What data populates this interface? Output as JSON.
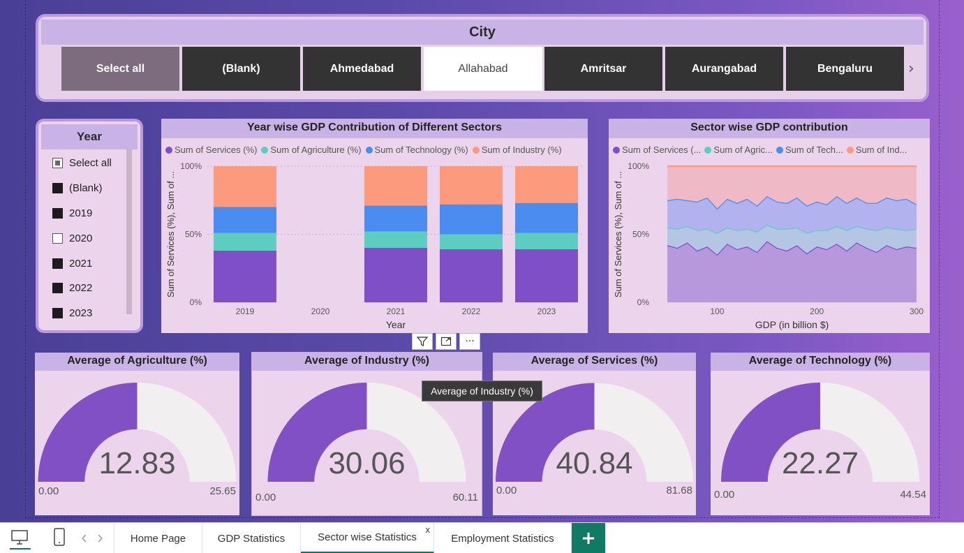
{
  "city_slicer": {
    "title": "City",
    "items": [
      "Select all",
      "(Blank)",
      "Ahmedabad",
      "Allahabad",
      "Amritsar",
      "Aurangabad",
      "Bengaluru"
    ],
    "selected": "Allahabad",
    "next_arrow": "›"
  },
  "year_slicer": {
    "title": "Year",
    "items": [
      {
        "label": "Select all",
        "state": "partial"
      },
      {
        "label": "(Blank)",
        "state": "checked"
      },
      {
        "label": "2019",
        "state": "checked"
      },
      {
        "label": "2020",
        "state": "unchecked"
      },
      {
        "label": "2021",
        "state": "checked"
      },
      {
        "label": "2022",
        "state": "checked"
      },
      {
        "label": "2023",
        "state": "checked"
      }
    ]
  },
  "colors": {
    "services": "#7f4fc7",
    "agriculture": "#5ccdc0",
    "technology": "#4a8cf0",
    "industry": "#fb9a7c"
  },
  "chart_data": [
    {
      "type": "bar",
      "stacked": "percent",
      "title": "Year wise GDP Contribution of Different Sectors",
      "legend": [
        "Sum of Services (%)",
        "Sum of Agriculture (%)",
        "Sum of Technology (%)",
        "Sum of Industry (%)"
      ],
      "xlabel": "Year",
      "ylabel": "Sum of Services (%), Sum of ...",
      "yticks": [
        "0%",
        "50%",
        "100%"
      ],
      "categories": [
        "2019",
        "2020",
        "2021",
        "2022",
        "2023"
      ],
      "series": [
        {
          "name": "Sum of Services (%)",
          "values": [
            38,
            null,
            40,
            39,
            39
          ]
        },
        {
          "name": "Sum of Agriculture (%)",
          "values": [
            13,
            null,
            12,
            11,
            12
          ]
        },
        {
          "name": "Sum of Technology (%)",
          "values": [
            19,
            null,
            19,
            22,
            22
          ]
        },
        {
          "name": "Sum of Industry (%)",
          "values": [
            30,
            null,
            29,
            28,
            27
          ]
        }
      ]
    },
    {
      "type": "area",
      "stacked": "percent",
      "title": "Sector wise GDP contribution",
      "legend": [
        "Sum of Services (...",
        "Sum of Agric...",
        "Sum of Tech...",
        "Sum of Ind..."
      ],
      "xlabel": "GDP (in billion $)",
      "ylabel": "Sum of Services (%), Sum of ...",
      "yticks": [
        "0%",
        "50%",
        "100%"
      ],
      "xticks": [
        "100",
        "200",
        "300"
      ],
      "xlim": [
        50,
        300
      ],
      "x": [
        50,
        60,
        70,
        80,
        90,
        100,
        110,
        120,
        130,
        140,
        150,
        160,
        170,
        180,
        190,
        200,
        210,
        220,
        230,
        240,
        250,
        260,
        270,
        280,
        290,
        300
      ],
      "series": [
        {
          "name": "Sum of Services (%)",
          "values": [
            42,
            40,
            44,
            38,
            41,
            35,
            43,
            39,
            41,
            37,
            45,
            40,
            38,
            42,
            36,
            41,
            39,
            43,
            38,
            44,
            40,
            37,
            42,
            39,
            41,
            40
          ]
        },
        {
          "name": "Sum of Agriculture (%)",
          "values": [
            13,
            14,
            12,
            15,
            13,
            16,
            12,
            14,
            13,
            15,
            12,
            14,
            16,
            13,
            15,
            12,
            14,
            13,
            15,
            12,
            14,
            16,
            13,
            15,
            12,
            14
          ]
        },
        {
          "name": "Sum of Technology (%)",
          "values": [
            20,
            22,
            19,
            21,
            23,
            18,
            21,
            20,
            22,
            19,
            21,
            20,
            19,
            22,
            20,
            21,
            19,
            22,
            20,
            21,
            19,
            20,
            22,
            21,
            23,
            18
          ]
        },
        {
          "name": "Sum of Industry (%)",
          "values": [
            25,
            24,
            25,
            26,
            23,
            31,
            24,
            27,
            24,
            29,
            22,
            26,
            27,
            23,
            29,
            26,
            28,
            22,
            27,
            23,
            27,
            27,
            23,
            25,
            24,
            28
          ]
        }
      ]
    }
  ],
  "gauges": [
    {
      "title": "Average of Agriculture (%)",
      "value": "12.83",
      "min": "0.00",
      "max": "25.65",
      "fraction": 0.5
    },
    {
      "title": "Average of Industry (%)",
      "value": "30.06",
      "min": "0.00",
      "max": "60.11",
      "fraction": 0.5
    },
    {
      "title": "Average of Services (%)",
      "value": "40.84",
      "min": "0.00",
      "max": "81.68",
      "fraction": 0.5
    },
    {
      "title": "Average of Technology (%)",
      "value": "22.27",
      "min": "0.00",
      "max": "44.54",
      "fraction": 0.5
    }
  ],
  "tooltip": "Average of Industry (%)",
  "toolbar": {
    "filter_icon": "filter-icon",
    "focus_icon": "focus-mode-icon",
    "more_icon": "more-options-icon",
    "more_label": "···"
  },
  "tabs": {
    "items": [
      "Home Page",
      "GDP Statistics",
      "Sector wise Statistics",
      "Employment Statistics"
    ],
    "active": "Sector wise Statistics",
    "close_label": "x",
    "add_label": "+"
  }
}
